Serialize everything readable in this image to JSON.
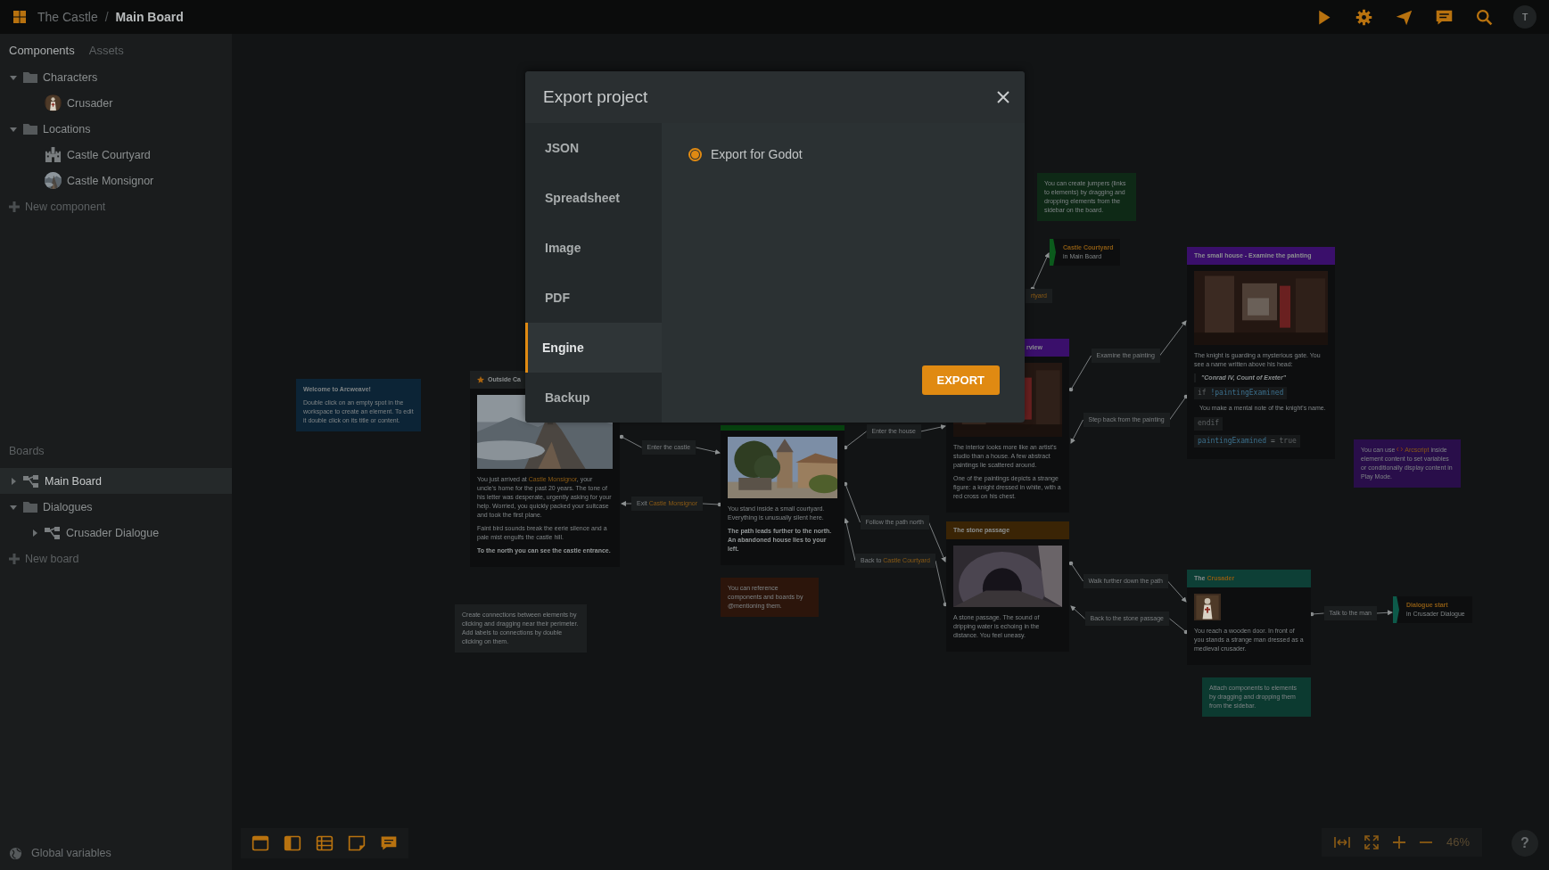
{
  "topbar": {
    "project": "The Castle",
    "separator": "/",
    "board": "Main Board",
    "avatar": "T"
  },
  "sidebar": {
    "tabs": [
      {
        "label": "Components",
        "selected": true
      },
      {
        "label": "Assets",
        "selected": false
      }
    ],
    "components": [
      {
        "label": "Characters",
        "kind": "folder",
        "expanded": true,
        "children": [
          {
            "label": "Crusader",
            "kind": "portrait"
          }
        ]
      },
      {
        "label": "Locations",
        "kind": "folder",
        "expanded": true,
        "children": [
          {
            "label": "Castle Courtyard",
            "kind": "castle"
          },
          {
            "label": "Castle Monsignor",
            "kind": "landscape"
          }
        ]
      }
    ],
    "new_component": "New component",
    "boards_title": "Boards",
    "boards": [
      {
        "label": "Main Board",
        "kind": "board",
        "expanded": false,
        "selected": true
      },
      {
        "label": "Dialogues",
        "kind": "folder",
        "expanded": true,
        "selected": false,
        "children": [
          {
            "label": "Crusader Dialogue",
            "kind": "board",
            "expanded": false,
            "selected": false
          }
        ]
      }
    ],
    "new_board": "New board",
    "global_variables": "Global variables"
  },
  "canvas": {
    "notes": [
      {
        "text": "Welcome to Arcweave!",
        "kind": "title",
        "color": "#0c2436",
        "body": "Double click on an empty spot in the workspace to create an element. To edit it double click on its title or content."
      },
      {
        "color": "#1c1f20",
        "body": "Create connections between elements by clicking and dragging near their perimeter. Add labels to connections by double clicking on them."
      },
      {
        "color": "#2c150b",
        "body": "You can reference components and boards by @mentioning them."
      },
      {
        "color": "#0e2916",
        "body": "You can create jumpers (links to elements) by dragging and dropping elements from the sidebar on the board."
      },
      {
        "color": "#290e4a",
        "body": [
          {
            "text": "You can use "
          },
          {
            "text": "Arcscript",
            "kind": "script"
          },
          {
            "text": " inside element content to set variables or conditionally display content in Play Mode."
          }
        ]
      },
      {
        "color": "#0c3a30",
        "body": "Attach components to elements by dragging and dropping them from the sidebar."
      }
    ],
    "nodes": [
      {
        "title": "Outside Ca",
        "starred": true,
        "color": "#1d2021",
        "paragraphs": [
          {
            "kind": "text",
            "parts": [
              {
                "text": "You just arrived at "
              },
              {
                "text": "Castle Monsignor",
                "kind": "mention"
              },
              {
                "text": ", your uncle's home for the past 20 years. The tone of his letter was desperate, urgently asking for your help. Worried, you quickly packed your suitcase and took the first plane."
              }
            ]
          },
          {
            "kind": "text",
            "parts": "Faint bird sounds break the eerie silence and a pale mist engulfs the castle hill."
          },
          {
            "kind": "bold",
            "parts": "To the north you can see the castle entrance."
          }
        ]
      },
      {
        "color": "#07420f",
        "paragraphs": [
          {
            "kind": "text",
            "parts": "You stand inside a small courtyard. Everything is unusually silent here."
          },
          {
            "kind": "bold",
            "parts": "The path leads further to the north. An abandoned house lies to your left."
          }
        ]
      },
      {
        "title": "rview",
        "color": "#3a0f6b",
        "paragraphs": [
          {
            "kind": "text",
            "parts": "The interior looks more like an artist's studio than a house. A few abstract paintings lie scattered around."
          },
          {
            "kind": "text",
            "parts": "One of the paintings depicts a strange figure: a knight dressed in white, with a red cross on his chest."
          }
        ]
      },
      {
        "title": "The stone passage",
        "color": "#3a2405",
        "paragraphs": [
          {
            "kind": "text",
            "parts": "A stone passage. The sound of dripping water is echoing in the distance. You feel uneasy."
          }
        ]
      },
      {
        "title": "The small house - Examine the painting",
        "color": "#3a0f6b",
        "paragraphs": [
          {
            "kind": "text",
            "parts": "The knight is guarding a mysterious gate. You see a name written above his head:"
          },
          {
            "kind": "quote",
            "parts": "\"Conrad IV, Count of Exeter\""
          },
          {
            "kind": "code",
            "parts": [
              {
                "text": "if ",
                "kind": "keyword"
              },
              {
                "text": "!paintingExamined",
                "kind": "variable"
              }
            ]
          },
          {
            "kind": "indent",
            "parts": "You make a mental note of the knight's name."
          },
          {
            "kind": "code",
            "parts": [
              {
                "text": "endif",
                "kind": "keyword"
              }
            ]
          },
          {
            "kind": "code",
            "parts": [
              {
                "text": "paintingExamined",
                "kind": "variable"
              },
              {
                "text": " = ",
                "kind": "op"
              },
              {
                "text": "true",
                "kind": "keyword"
              }
            ]
          }
        ]
      },
      {
        "title": [
          {
            "text": "The "
          },
          {
            "text": "Crusader",
            "kind": "mention"
          }
        ],
        "color": "#0d3f36",
        "paragraphs": [
          {
            "kind": "text",
            "parts": "You reach a wooden door. In front of you stands a strange man dressed as a medieval crusader."
          }
        ]
      }
    ],
    "jumpers": [
      {
        "title": "Castle Courtyard",
        "subtitle": "in Main Board",
        "color": "#0b5a1c"
      },
      {
        "title": "Dialogue start",
        "subtitle": "in Crusader Dialogue",
        "color": "#0d5a4a"
      }
    ],
    "labels": [
      "Enter the castle",
      [
        {
          "text": "Exit "
        },
        {
          "text": "Castle Monsignor",
          "kind": "mention"
        }
      ],
      "Enter the house",
      "Follow the path north",
      [
        {
          "text": "Back to "
        },
        {
          "text": "Castle Courtyard",
          "kind": "mention"
        }
      ],
      "Examine the painting",
      "Step back from the painting",
      "Walk further down the path",
      "Back to the stone passage",
      "Talk to the man",
      [
        {
          "text": "rtyard",
          "kind": "mention"
        }
      ]
    ],
    "zoom": "46%",
    "help": "?"
  },
  "modal": {
    "title": "Export project",
    "nav": [
      {
        "label": "JSON",
        "selected": false
      },
      {
        "label": "Spreadsheet",
        "selected": false
      },
      {
        "label": "Image",
        "selected": false
      },
      {
        "label": "PDF",
        "selected": false
      },
      {
        "label": "Engine",
        "selected": true
      },
      {
        "label": "Backup",
        "selected": false
      }
    ],
    "options": [
      {
        "label": "Export for Godot",
        "selected": true
      }
    ],
    "button": "EXPORT"
  }
}
